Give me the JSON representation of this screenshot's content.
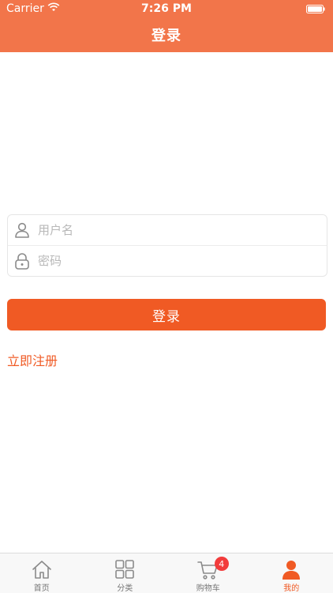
{
  "status_bar": {
    "carrier": "Carrier",
    "time": "7:26 PM"
  },
  "nav": {
    "title": "登录"
  },
  "form": {
    "username_placeholder": "用户名",
    "password_placeholder": "密码"
  },
  "login_button": "登录",
  "register_link": "立即注册",
  "tabs": [
    {
      "label": "首页",
      "icon": "home-icon"
    },
    {
      "label": "分类",
      "icon": "grid-icon"
    },
    {
      "label": "购物车",
      "icon": "cart-icon",
      "badge": "4"
    },
    {
      "label": "我的",
      "icon": "user-icon"
    }
  ],
  "colors": {
    "header": "#f2754a",
    "accent": "#f05a24",
    "badge": "#f23c3c"
  }
}
